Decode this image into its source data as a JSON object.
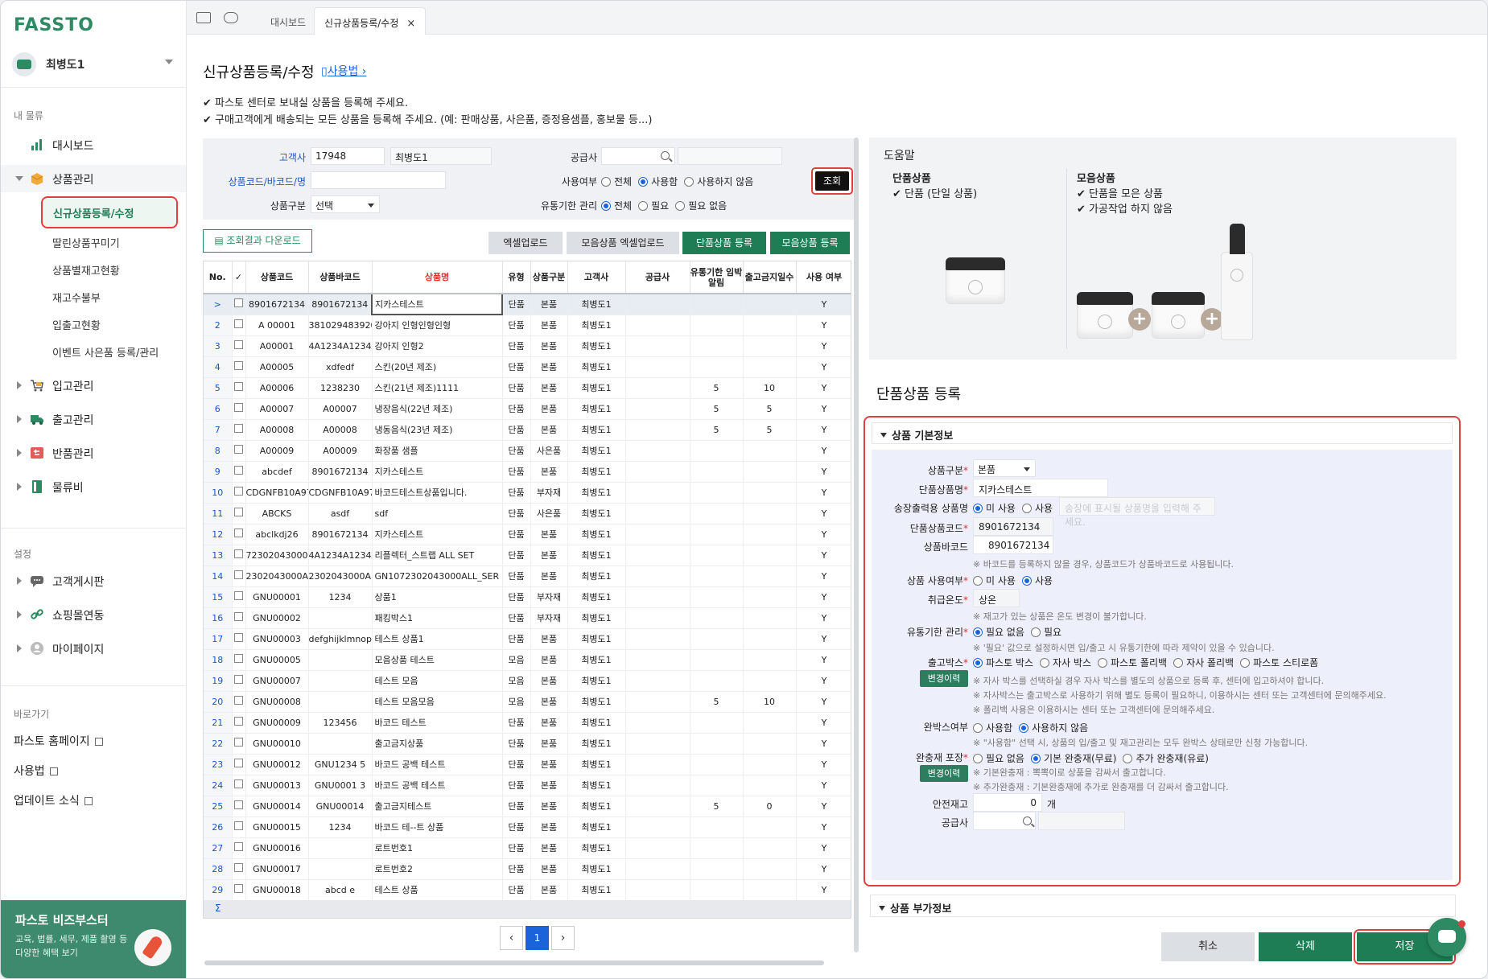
{
  "brand": {
    "logo": "FASSTO",
    "accent": "#1e7d55",
    "highlight": "#e04040",
    "link": "#1a63d8"
  },
  "user": {
    "name": "최병도1"
  },
  "sidebar": {
    "section_logistics": "내 물류",
    "items": [
      {
        "label": "대시보드",
        "icon": "bar-chart-icon"
      },
      {
        "label": "상품관리",
        "icon": "box-icon"
      },
      {
        "label": "입고관리",
        "icon": "cart-icon"
      },
      {
        "label": "출고관리",
        "icon": "truck-icon"
      },
      {
        "label": "반품관리",
        "icon": "return-icon"
      },
      {
        "label": "물류비",
        "icon": "ledger-icon"
      }
    ],
    "product_sub": [
      "신규상품등록/수정",
      "딸린상품꾸미기",
      "상품별재고현황",
      "재고수불부",
      "입출고현황",
      "이벤트 사은품 등록/관리"
    ],
    "section_settings": "설정",
    "settings_items": [
      {
        "label": "고객게시판",
        "icon": "chat-bubble-icon"
      },
      {
        "label": "쇼핑몰연동",
        "icon": "link-icon"
      },
      {
        "label": "마이페이지",
        "icon": "user-icon"
      }
    ],
    "section_quick": "바로가기",
    "quick_links": [
      "파스토 홈페이지",
      "사용법",
      "업데이트 소식"
    ],
    "banner": {
      "title": "파스토 비즈부스터",
      "line1": "교육, 법률, 세무, 제품 촬영 등",
      "line2": "다양한 혜택 보기"
    }
  },
  "tabs": [
    {
      "label": "대시보드"
    },
    {
      "label": "신규상품등록/수정",
      "close": "×"
    }
  ],
  "page": {
    "title": "신규상품등록/수정",
    "howto": "사용법",
    "notes": [
      "✔ 파스토 센터로 보내실 상품을 등록해 주세요.",
      "✔ 구매고객에게 배송되는 모든 상품을 등록해 주세요. (예: 판매상품, 사은품, 증정용샘플, 홍보물 등...)"
    ]
  },
  "filter": {
    "customer_label": "고객사",
    "customer_code": "17948",
    "customer_name": "최병도1",
    "code_label": "상품코드/바코드/명",
    "code_value": "",
    "type_label": "상품구분",
    "type_value": "선택",
    "supplier_label": "공급사",
    "use_label": "사용여부",
    "use_options": [
      "전체",
      "사용함",
      "사용하지 않음"
    ],
    "use_selected": 1,
    "expiry_label": "유통기한 관리",
    "expiry_options": [
      "전체",
      "필요",
      "필요 없음"
    ],
    "expiry_selected": 0,
    "search_button": "조회"
  },
  "toolbar": {
    "download": "조회결과 다운로드",
    "excel_upload": "엑셀업로드",
    "set_excel_upload": "모음상품 엑셀업로드",
    "single_register": "단품상품 등록",
    "set_register": "모음상품 등록"
  },
  "grid": {
    "headers": [
      "No.",
      "✓",
      "상품코드",
      "상품바코드",
      "상품명",
      "유형",
      "상품구분",
      "고객사",
      "공급사",
      "유통기한 임박 알림",
      "출고금지일수",
      "사용 여부"
    ],
    "rows": [
      [
        ">",
        "8901672134",
        "8901672134",
        "지카스테스트",
        "단품",
        "본품",
        "최병도1",
        "",
        "",
        "",
        "Y"
      ],
      [
        "2",
        "A 00001",
        "381029483920",
        "강아지 인형인형인형",
        "단품",
        "본품",
        "최병도1",
        "",
        "",
        "",
        "Y"
      ],
      [
        "3",
        "A00001",
        "4A1234A1234A",
        "강아지 인형2",
        "단품",
        "본품",
        "최병도1",
        "",
        "",
        "",
        "Y"
      ],
      [
        "4",
        "A00005",
        "xdfedf",
        "스킨(20년 제조)",
        "단품",
        "본품",
        "최병도1",
        "",
        "",
        "",
        "Y"
      ],
      [
        "5",
        "A00006",
        "1238230",
        "스킨(21년 제조)1111",
        "단품",
        "본품",
        "최병도1",
        "",
        "5",
        "10",
        "Y"
      ],
      [
        "6",
        "A00007",
        "A00007",
        "냉장음식(22년 제조)",
        "단품",
        "본품",
        "최병도1",
        "",
        "5",
        "5",
        "Y"
      ],
      [
        "7",
        "A00008",
        "A00008",
        "냉동음식(23년 제조)",
        "단품",
        "본품",
        "최병도1",
        "",
        "5",
        "5",
        "Y"
      ],
      [
        "8",
        "A00009",
        "A00009",
        "화장품 샘플",
        "단품",
        "사은품",
        "최병도1",
        "",
        "",
        "",
        "Y"
      ],
      [
        "9",
        "abcdef",
        "8901672134",
        "지카스테스트",
        "단품",
        "본품",
        "최병도1",
        "",
        "",
        "",
        "Y"
      ],
      [
        "10",
        "CDGNFB10A97",
        "CDGNFB10A97",
        "바코드테스트상품입니다.",
        "단품",
        "부자재",
        "최병도1",
        "",
        "",
        "",
        "Y"
      ],
      [
        "11",
        "ABCKS",
        "asdf",
        "sdf",
        "단품",
        "사은품",
        "최병도1",
        "",
        "",
        "",
        "Y"
      ],
      [
        "12",
        "abclkdj26",
        "8901672134",
        "지카스테스트",
        "단품",
        "본품",
        "최병도1",
        "",
        "",
        "",
        "Y"
      ],
      [
        "13",
        "72302043000",
        "4A1234A1234A",
        "리플렉터_스트랩 ALL SET",
        "단품",
        "본품",
        "최병도1",
        "",
        "",
        "",
        "Y"
      ],
      [
        "14",
        "2302043000AL",
        "2302043000AL",
        "GN1072302043000ALL_SER",
        "단품",
        "본품",
        "최병도1",
        "",
        "",
        "",
        "Y"
      ],
      [
        "15",
        "GNU00001",
        "1234",
        "상품1",
        "단품",
        "부자재",
        "최병도1",
        "",
        "",
        "",
        "Y"
      ],
      [
        "16",
        "GNU00002",
        "",
        "패킹박스1",
        "단품",
        "부자재",
        "최병도1",
        "",
        "",
        "",
        "Y"
      ],
      [
        "17",
        "GNU00003",
        "defghijklmnop",
        "테스트 상품1",
        "단품",
        "본품",
        "최병도1",
        "",
        "",
        "",
        "Y"
      ],
      [
        "18",
        "GNU00005",
        "",
        "모음상품 테스트",
        "모음",
        "본품",
        "최병도1",
        "",
        "",
        "",
        "Y"
      ],
      [
        "19",
        "GNU00007",
        "",
        "테스트 모음",
        "모음",
        "본품",
        "최병도1",
        "",
        "",
        "",
        "Y"
      ],
      [
        "20",
        "GNU00008",
        "",
        "테스트 모음모음",
        "모음",
        "본품",
        "최병도1",
        "",
        "5",
        "10",
        "Y"
      ],
      [
        "21",
        "GNU00009",
        "123456",
        "바코드 테스트",
        "단품",
        "본품",
        "최병도1",
        "",
        "",
        "",
        "Y"
      ],
      [
        "22",
        "GNU00010",
        "",
        "출고금지상품",
        "단품",
        "본품",
        "최병도1",
        "",
        "",
        "",
        "Y"
      ],
      [
        "23",
        "GNU00012",
        "GNU1234 5",
        "바코드 공백 테스트",
        "단품",
        "본품",
        "최병도1",
        "",
        "",
        "",
        "Y"
      ],
      [
        "24",
        "GNU00013",
        "GNU0001 3",
        "바코드 공백 테스트",
        "단품",
        "본품",
        "최병도1",
        "",
        "",
        "",
        "Y"
      ],
      [
        "25",
        "GNU00014",
        "GNU00014",
        "출고금지테스트",
        "단품",
        "본품",
        "최병도1",
        "",
        "5",
        "0",
        "Y"
      ],
      [
        "26",
        "GNU00015",
        "1234",
        "바코드 테--트 상품",
        "단품",
        "본품",
        "최병도1",
        "",
        "",
        "",
        "Y"
      ],
      [
        "27",
        "GNU00016",
        "",
        "로트번호1",
        "단품",
        "본품",
        "최병도1",
        "",
        "",
        "",
        "Y"
      ],
      [
        "28",
        "GNU00017",
        "",
        "로트번호2",
        "단품",
        "본품",
        "최병도1",
        "",
        "",
        "",
        "Y"
      ],
      [
        "29",
        "GNU00018",
        "abcd e",
        "테스트 상품",
        "단품",
        "본품",
        "최병도1",
        "",
        "",
        "",
        "Y"
      ]
    ],
    "sigma": "Σ"
  },
  "pagination": {
    "prev": "‹",
    "page": "1",
    "next": "›"
  },
  "help": {
    "title": "도움말",
    "single_title": "단품상품",
    "single_items": [
      "✔ 단품 (단일 상품)"
    ],
    "set_title": "모음상품",
    "set_items": [
      "✔ 단품을 모은 상품",
      "✔ 가공작업 하지 않음"
    ],
    "plus": "+"
  },
  "form": {
    "title": "단품상품 등록",
    "section_basic": "상품 기본정보",
    "type_label": "상품구분",
    "type_value": "본품",
    "name_label": "단품상품명",
    "name_value": "지카스테스트",
    "ship_name_label": "송장출력용 상품명",
    "ship_name_options": [
      "미 사용",
      "사용"
    ],
    "ship_name_placeholder": "송장에 표시될 상품명을 입력해 주세요.",
    "code_label": "단품상품코드",
    "code_value": "8901672134",
    "barcode_label": "상품바코드",
    "barcode_value": "8901672134",
    "barcode_hint": "※ 바코드를 등록하지 않을 경우, 상품코드가 상품바코드로 사용됩니다.",
    "use_label": "상품 사용여부",
    "use_options": [
      "미 사용",
      "사용"
    ],
    "temp_label": "취급온도",
    "temp_value": "상온",
    "temp_hint": "※ 재고가 있는 상품은 온도 변경이 불가합니다.",
    "expiry_label": "유통기한 관리",
    "expiry_options": [
      "필요 없음",
      "필요"
    ],
    "expiry_hint": "※ '필요' 값으로 설정하시면 입/출고 시 유통기한에 따라 제약이 있을 수 있습니다.",
    "box_label": "출고박스",
    "box_options": [
      "파스토 박스",
      "자사 박스",
      "파스토 폴리백",
      "자사 폴리백",
      "파스토 스티로폼"
    ],
    "history_btn": "변경이력",
    "box_hints": [
      "※ 자사 박스를 선택하실 경우 자사 박스를 별도의 상품으로 등록 후, 센터에 입고하셔야 합니다.",
      "※ 자사박스는 출고박스로 사용하기 위해 별도 등록이 필요하니, 이용하시는 센터 또는 고객센터에 문의해주세요.",
      "※ 폴리백 사용은 이용하시는 센터 또는 고객센터에 문의해주세요."
    ],
    "complete_label": "완박스여부",
    "complete_options": [
      "사용함",
      "사용하지 않음"
    ],
    "complete_hint": "※ \"사용함\" 선택 시, 상품의 입/출고 및 재고관리는 모두 완박스 상태로만 신청 가능합니다.",
    "cushion_label": "완충재 포장",
    "cushion_options": [
      "필요 없음",
      "기본 완충재(무료)",
      "추가 완충재(유료)"
    ],
    "cushion_hints": [
      "※ 기본완충재 : 뽁뽁이로 상품을 감싸서 출고합니다.",
      "※ 추가완충재 : 기본완충재에 추가로 완충재를 더 감싸서 출고합니다."
    ],
    "safe_stock_label": "안전재고",
    "safe_stock_value": "0",
    "safe_stock_unit": "개",
    "supplier_label": "공급사",
    "required_mark": "*",
    "section_extra": "상품 부가정보"
  },
  "actions": {
    "cancel": "취소",
    "delete": "삭제",
    "save": "저장"
  }
}
